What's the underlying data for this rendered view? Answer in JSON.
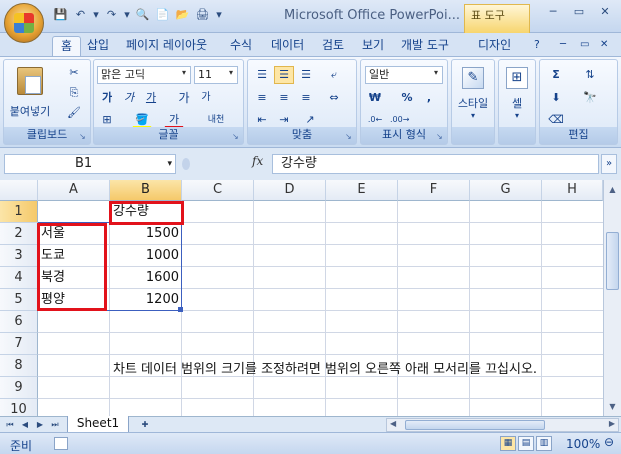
{
  "window": {
    "title": "Microsoft Office PowerPoi...",
    "context_tab": "표 도구",
    "minimize": "─",
    "maximize": "▭",
    "close": "✕"
  },
  "qat": [
    "💾",
    "↶",
    "▾",
    "↷",
    "▾",
    "🔍",
    "📄",
    "📂",
    "🖨",
    "▾"
  ],
  "tabs": [
    {
      "label": "홈",
      "active": true
    },
    {
      "label": "삽입"
    },
    {
      "label": "페이지 레이아웃"
    },
    {
      "label": "수식"
    },
    {
      "label": "데이터"
    },
    {
      "label": "검토"
    },
    {
      "label": "보기"
    },
    {
      "label": "개발 도구"
    },
    {
      "label": "디자인"
    }
  ],
  "ribbon": {
    "clipboard": {
      "label": "클립보드",
      "paste": "붙여넣기"
    },
    "font": {
      "label": "글꼴",
      "name": "맑은 고딕",
      "size": "11",
      "bold": "가",
      "grow": "가",
      "shrink": "가",
      "italic": "가",
      "underline": "가",
      "color_a": "가",
      "phonetic": "내천"
    },
    "alignment": {
      "label": "맞춤"
    },
    "number": {
      "label": "표시 형식",
      "format": "일반",
      "currency": "₩",
      "percent": "%",
      "comma": ","
    },
    "styles": {
      "label": "스타일"
    },
    "cells": {
      "label": "셀"
    },
    "editing": {
      "label": "편집"
    }
  },
  "formula": {
    "name_box": "B1",
    "fx": "fx",
    "content": "강수량"
  },
  "columns": [
    "A",
    "B",
    "C",
    "D",
    "E",
    "F",
    "G",
    "H"
  ],
  "rows": [
    "1",
    "2",
    "3",
    "4",
    "5",
    "6",
    "7",
    "8",
    "9",
    "10"
  ],
  "cells": {
    "b1": "강수량",
    "a2": "서울",
    "b2": "1500",
    "a3": "도쿄",
    "b3": "1000",
    "a4": "북경",
    "b4": "1600",
    "a5": "평양",
    "b5": "1200"
  },
  "hint": "차트 데이터 범위의 크기를 조정하려면 범위의 오른쪽 아래 모서리를 끄십시오.",
  "sheet": {
    "tab": "Sheet1"
  },
  "status": {
    "ready": "준비",
    "zoom": "100%"
  },
  "colors": {
    "highlight": "#e2121b",
    "selection": "#3c5fbf",
    "accent": "#15428b"
  }
}
